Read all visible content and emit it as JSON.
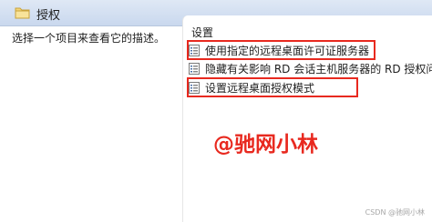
{
  "header": {
    "title": "授权",
    "icon": "folder-icon"
  },
  "description": {
    "text": "选择一个项目来查看它的描述。"
  },
  "list": {
    "column_header": "设置",
    "items": [
      {
        "label": "使用指定的远程桌面许可证服务器",
        "icon": "policy-setting-icon",
        "highlighted": true
      },
      {
        "label": "隐藏有关影响 RD 会话主机服务器的 RD 授权问题",
        "icon": "policy-setting-icon",
        "highlighted": false
      },
      {
        "label": "设置远程桌面授权模式",
        "icon": "policy-setting-icon",
        "highlighted": true
      }
    ]
  },
  "annotation": {
    "text": "@驰网小林",
    "color": "#e8291f"
  },
  "credit": {
    "text": "CSDN @驰网小林"
  },
  "colors": {
    "highlight": "#e8291f",
    "header_bg": "#c9d8ee"
  }
}
